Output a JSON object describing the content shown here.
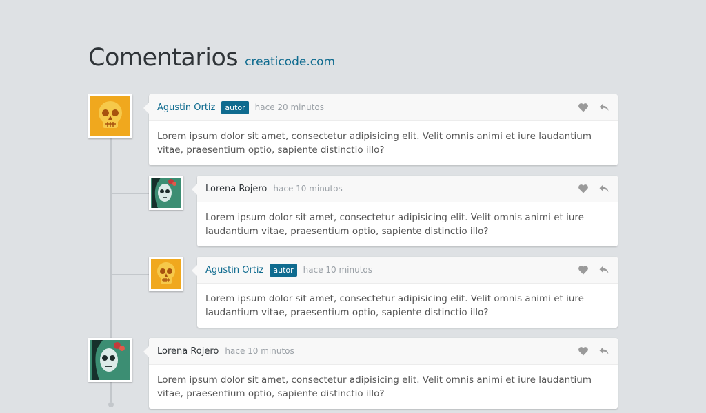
{
  "header": {
    "title": "Comentarios",
    "link": "creaticode.com"
  },
  "comments": [
    {
      "author": "Agustin Ortiz",
      "badge": "autor",
      "time": "hace 20 minutos",
      "text": "Lorem ipsum dolor sit amet, consectetur adipisicing elit. Velit omnis animi et iure laudantium vitae, praesentium optio, sapiente distinctio illo?"
    },
    {
      "author": "Lorena Rojero",
      "time": "hace 10 minutos",
      "text": "Lorem ipsum dolor sit amet, consectetur adipisicing elit. Velit omnis animi et iure laudantium vitae, praesentium optio, sapiente distinctio illo?"
    },
    {
      "author": "Agustin Ortiz",
      "badge": "autor",
      "time": "hace 10 minutos",
      "text": "Lorem ipsum dolor sit amet, consectetur adipisicing elit. Velit omnis animi et iure laudantium vitae, praesentium optio, sapiente distinctio illo?"
    },
    {
      "author": "Lorena Rojero",
      "time": "hace 10 minutos",
      "text": "Lorem ipsum dolor sit amet, consectetur adipisicing elit. Velit omnis animi et iure laudantium vitae, praesentium optio, sapiente distinctio illo?"
    }
  ],
  "icons": {
    "like": "heart-icon",
    "reply": "reply-icon"
  },
  "colors": {
    "background": "#dee1e4",
    "accent": "#0f6b8f",
    "title": "#2f3438"
  }
}
